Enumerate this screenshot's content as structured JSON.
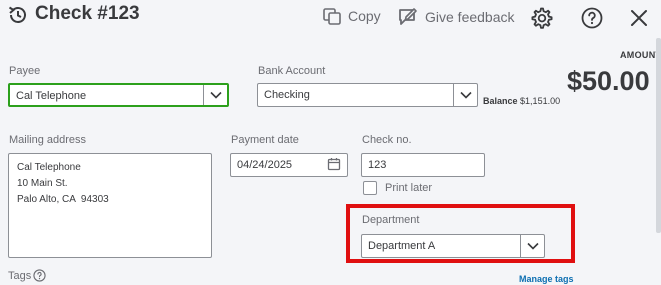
{
  "header": {
    "title": "Check #123",
    "copy_label": "Copy",
    "feedback_label": "Give feedback"
  },
  "amount": {
    "label": "AMOUNT",
    "value": "$50.00"
  },
  "payee": {
    "label": "Payee",
    "value": "Cal Telephone"
  },
  "bank_account": {
    "label": "Bank Account",
    "value": "Checking",
    "balance_label": "Balance",
    "balance_value": "$1,151.00"
  },
  "mailing_address": {
    "label": "Mailing address",
    "value": "Cal Telephone\n10 Main St.\nPalo Alto, CA  94303"
  },
  "payment_date": {
    "label": "Payment date",
    "value": "04/24/2025"
  },
  "check_no": {
    "label": "Check no.",
    "value": "123"
  },
  "print_later": {
    "label": "Print later",
    "checked": false
  },
  "department": {
    "label": "Department",
    "value": "Department A"
  },
  "tags": {
    "label": "Tags",
    "manage_label": "Manage tags"
  },
  "colors": {
    "focus_green": "#2ca01c",
    "highlight_red": "#e00f10",
    "link_blue": "#0d6fb1"
  }
}
